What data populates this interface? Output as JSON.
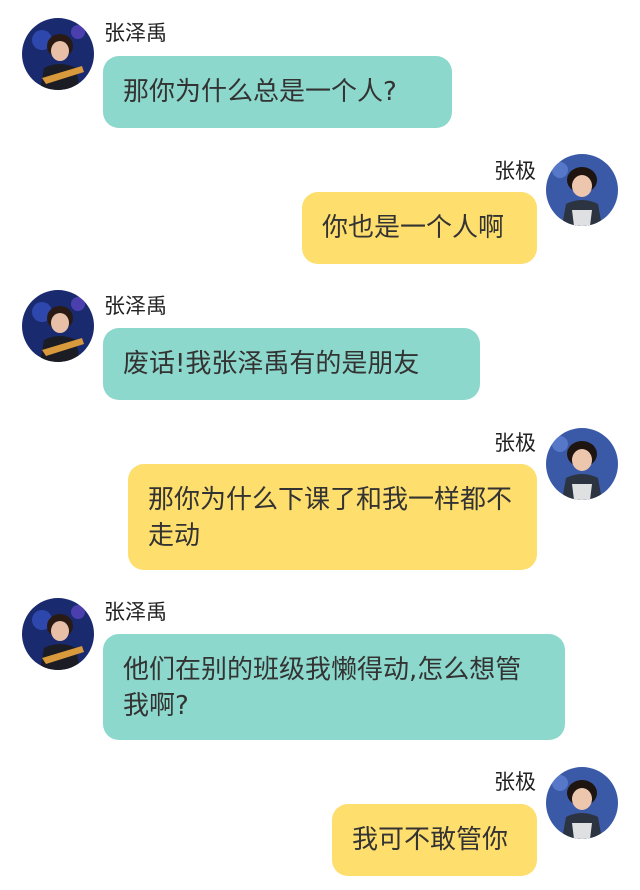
{
  "colors": {
    "left_bubble": "#8dd8cc",
    "right_bubble": "#fede6c"
  },
  "messages": [
    {
      "side": "left",
      "sender": "张泽禹",
      "avatar": "avatar-zhangzeyu-icon",
      "text": "那你为什么总是一个人?"
    },
    {
      "side": "right",
      "sender": "张极",
      "avatar": "avatar-zhangji-icon",
      "text": "你也是一个人啊"
    },
    {
      "side": "left",
      "sender": "张泽禹",
      "avatar": "avatar-zhangzeyu-icon",
      "text": "废话!我张泽禹有的是朋友"
    },
    {
      "side": "right",
      "sender": "张极",
      "avatar": "avatar-zhangji-icon",
      "text": "那你为什么下课了和我一样都不走动"
    },
    {
      "side": "left",
      "sender": "张泽禹",
      "avatar": "avatar-zhangzeyu-icon",
      "text": "他们在别的班级我懒得动,怎么想管我啊?"
    },
    {
      "side": "right",
      "sender": "张极",
      "avatar": "avatar-zhangji-icon",
      "text": "我可不敢管你"
    }
  ]
}
